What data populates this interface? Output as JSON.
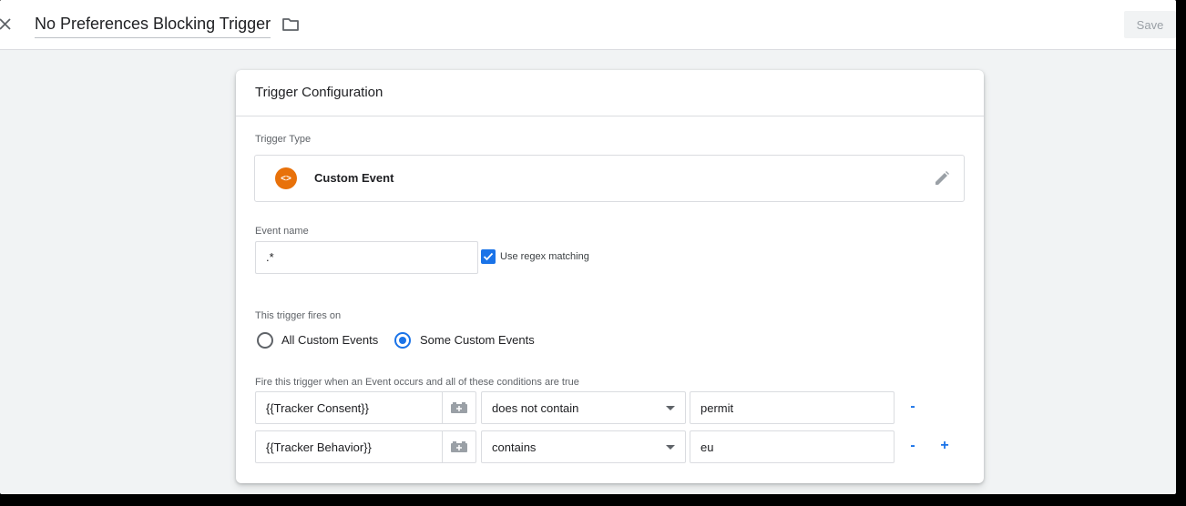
{
  "header": {
    "title": "No Preferences Blocking Trigger",
    "save_label": "Save",
    "close_icon": "close-icon",
    "folder_icon": "folder-icon"
  },
  "card": {
    "title": "Trigger Configuration",
    "trigger_type_label": "Trigger Type",
    "trigger_type_value": "Custom Event",
    "trigger_type_icon_glyph": "<>",
    "event_name_label": "Event name",
    "event_name_value": ".*",
    "use_regex_label": "Use regex matching",
    "use_regex_checked": true,
    "fires_on_label": "This trigger fires on",
    "fires_on_options": [
      {
        "label": "All Custom Events",
        "selected": false
      },
      {
        "label": "Some Custom Events",
        "selected": true
      }
    ],
    "conditions_label": "Fire this trigger when an Event occurs and all of these conditions are true",
    "conditions": [
      {
        "variable": "{{Tracker Consent}}",
        "operator": "does not contain",
        "value": "permit",
        "remove_label": "-",
        "add_label": ""
      },
      {
        "variable": "{{Tracker Behavior}}",
        "operator": "contains",
        "value": "eu",
        "remove_label": "-",
        "add_label": "+"
      }
    ]
  },
  "colors": {
    "accent": "#1a73e8",
    "custom_event_icon": "#e8710a",
    "background": "#f1f3f4"
  }
}
